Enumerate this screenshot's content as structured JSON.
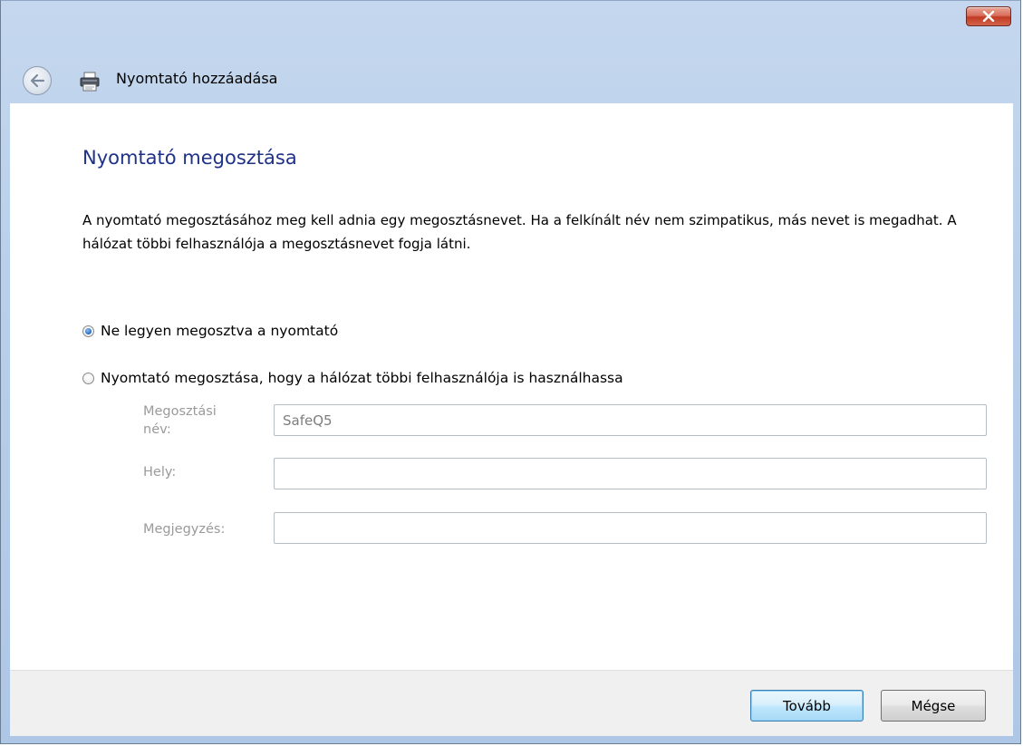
{
  "window": {
    "title": "Nyomtató hozzáadása",
    "close_symbol": "×"
  },
  "icons": {
    "close": "close-icon",
    "back": "back-arrow-icon",
    "printer": "printer-icon"
  },
  "page": {
    "heading": "Nyomtató megosztása",
    "description": "A nyomtató megosztásához meg kell adnia egy megosztásnevet. Ha a felkínált név nem szimpatikus, más nevet is megadhat. A hálózat többi felhasználója a megosztásnevet fogja látni."
  },
  "options": {
    "no_share": {
      "label": "Ne legyen megosztva a nyomtató",
      "selected": true
    },
    "share": {
      "label": "Nyomtató megosztása, hogy a hálózat többi felhasználója is használhassa",
      "selected": false
    }
  },
  "fields": {
    "share_name": {
      "label": "Megosztási név:",
      "value": "SafeQ5"
    },
    "location": {
      "label": "Hely:",
      "value": ""
    },
    "comment": {
      "label": "Megjegyzés:",
      "value": ""
    }
  },
  "footer": {
    "next_label": "Tovább",
    "cancel_label": "Mégse"
  },
  "colors": {
    "heading": "#1e3287",
    "disabled_text": "#9a9a9a",
    "close_button": "#c13a23",
    "frame": "#b9cfea"
  }
}
